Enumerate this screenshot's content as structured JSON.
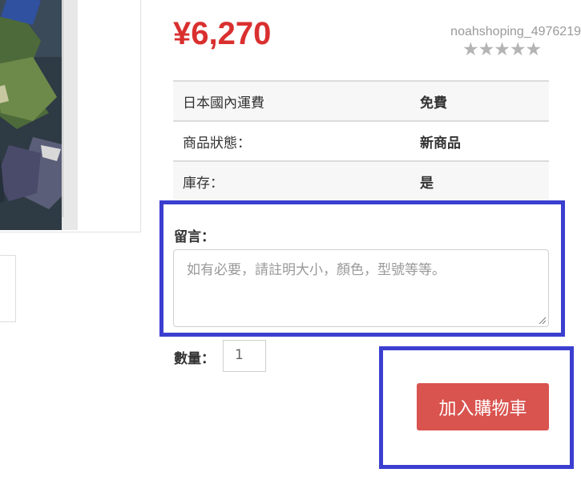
{
  "product": {
    "price": "¥6,270",
    "seller_name": "noahshoping_4976219",
    "rating_stars": "★★★★★"
  },
  "info_rows": [
    {
      "label": "日本國內運費",
      "value": "免費"
    },
    {
      "label": "商品狀態：",
      "value": "新商品"
    },
    {
      "label": "庫存：",
      "value": "是"
    }
  ],
  "message": {
    "label": "留言：",
    "placeholder": "如有必要，請註明大小，顏色，型號等等。"
  },
  "quantity": {
    "label": "數量：",
    "value": "1"
  },
  "cart": {
    "button_label": "加入購物車"
  },
  "colors": {
    "price": "#d9302f",
    "cart_button": "#d9534f",
    "highlight": "#3b3fcf"
  }
}
